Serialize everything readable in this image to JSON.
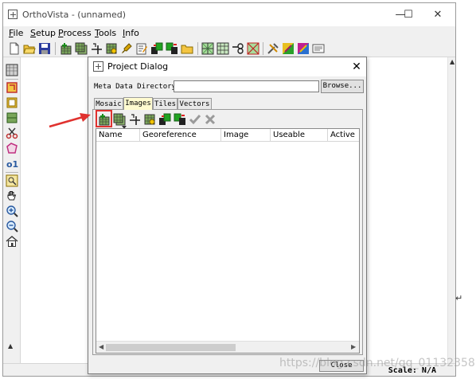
{
  "window": {
    "title": "OrthoVista - (unnamed)",
    "controls": {
      "minimize": "—",
      "maximize": "☐",
      "close": "✕"
    }
  },
  "menu": {
    "file": {
      "key": "F",
      "rest": "ile"
    },
    "setup": {
      "key": "S",
      "rest": "etup"
    },
    "process": {
      "key": "P",
      "rest": "rocess"
    },
    "tools": {
      "key": "T",
      "rest": "ools"
    },
    "info": {
      "key": "I",
      "rest": "nfo"
    }
  },
  "toolbar_icons": [
    "new-file-icon",
    "open-folder-icon",
    "save-icon",
    "add-image-icon",
    "add-multiple-images-icon",
    "tie-point-icon",
    "image-settings-icon",
    "brush-icon",
    "edit-document-icon",
    "transfer-icon",
    "transfer-alt-icon",
    "folder-icon",
    "grid-mosaic-icon",
    "grid-tiles-icon",
    "link-icon",
    "seamline-icon",
    "tools-icon",
    "color-balance-icon",
    "color-swatch-icon",
    "report-icon"
  ],
  "left_toolbar_icons": [
    "image-panel-icon",
    "rotate-icon",
    "frame-icon",
    "green-frame-icon",
    "scissors-icon",
    "polygon-icon",
    "value-icon",
    "zoom-area-icon",
    "hand-pan-icon",
    "zoom-in-icon",
    "zoom-out-icon",
    "home-icon"
  ],
  "canvas": {
    "scroll_indicator": "▲"
  },
  "status": {
    "scale": "Scale: N/A"
  },
  "dialog": {
    "title": "Project Dialog",
    "close": "✕",
    "meta_label": "Meta Data Directory",
    "meta_value": "",
    "browse": "Browse...",
    "tabs": [
      "Mosaic",
      "Images",
      "Tiles",
      "Vectors"
    ],
    "active_tab": "Images",
    "toolbar_icons": [
      "add-image-icon",
      "add-multiple-images-icon",
      "tie-point-icon",
      "image-settings-icon",
      "transfer-icon",
      "transfer-alt-icon",
      "accept-icon",
      "reject-icon"
    ],
    "columns": [
      "Name",
      "Georeference",
      "Image",
      "Useable",
      "Active"
    ],
    "close_button": "Close"
  },
  "annotation": {
    "color": "#e0322f"
  },
  "watermark": "https://blog.csdn.net/qq_01132358",
  "colors": {
    "accent": "#e0322f",
    "tab_active": "#fffbd0",
    "window_bg": "#f0f0f0"
  }
}
